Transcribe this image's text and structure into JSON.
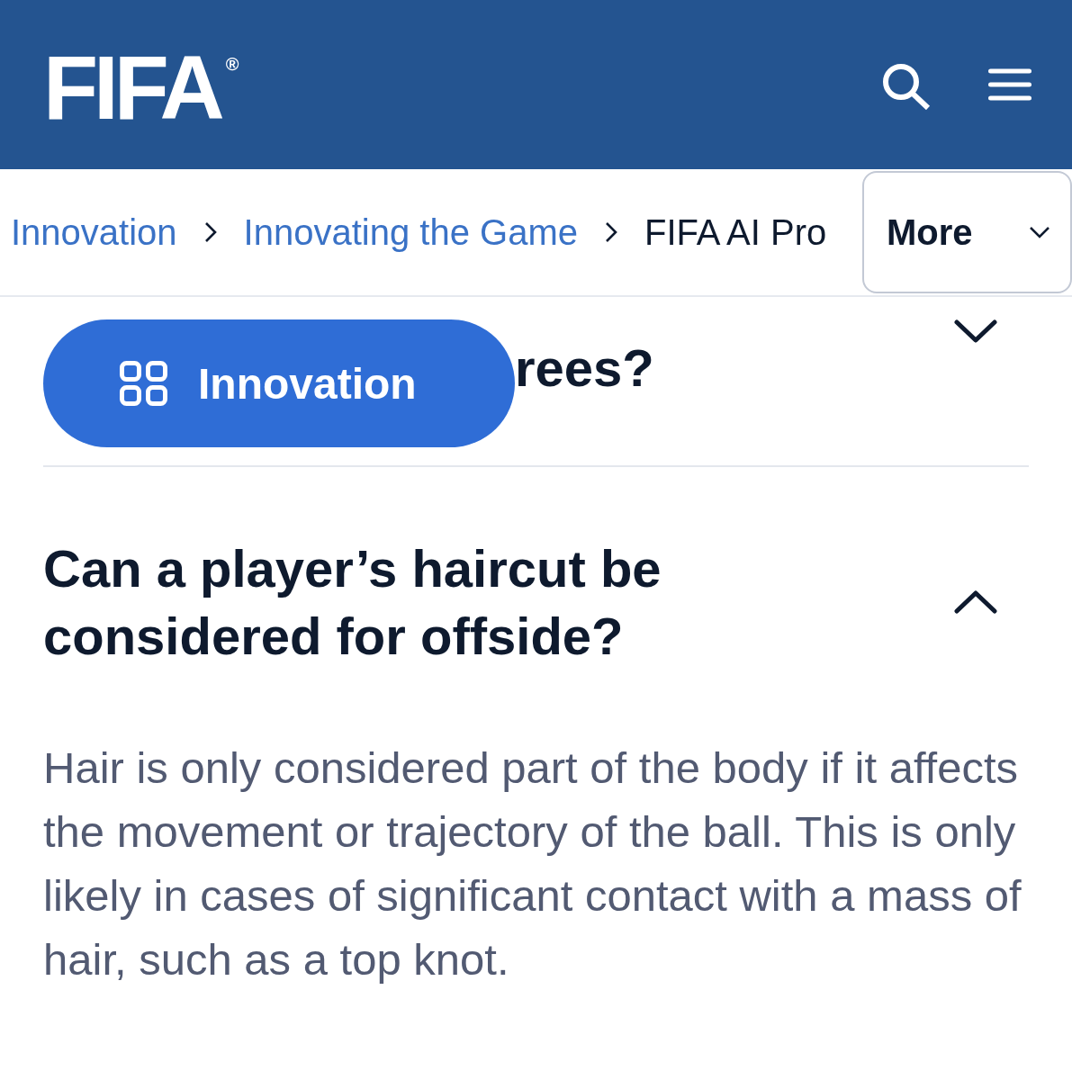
{
  "header": {
    "logo": "FIFA$^{®}$"
  },
  "breadcrumb": [
    {
      "label": "Innovation",
      "current": false
    },
    {
      "label": "Innovating the Game",
      "current": false
    },
    {
      "label": "FIFA AI Pro",
      "current": true
    }
  ],
  "more_button": {
    "label": "More"
  },
  "floating_button": {
    "label": "Innovation"
  },
  "faq": [
    {
      "kind": "partly-covered",
      "question_fragment": "rees?",
      "expanded": false
    },
    {
      "kind": "full",
      "question": "Can a player’s haircut be considered for offside?",
      "expanded": true,
      "answer": "Hair is only considered part of the body if it affects the movement or trajectory of the ball. This is only likely in cases of significant contact with a mass of hair, such as a top knot."
    }
  ]
}
